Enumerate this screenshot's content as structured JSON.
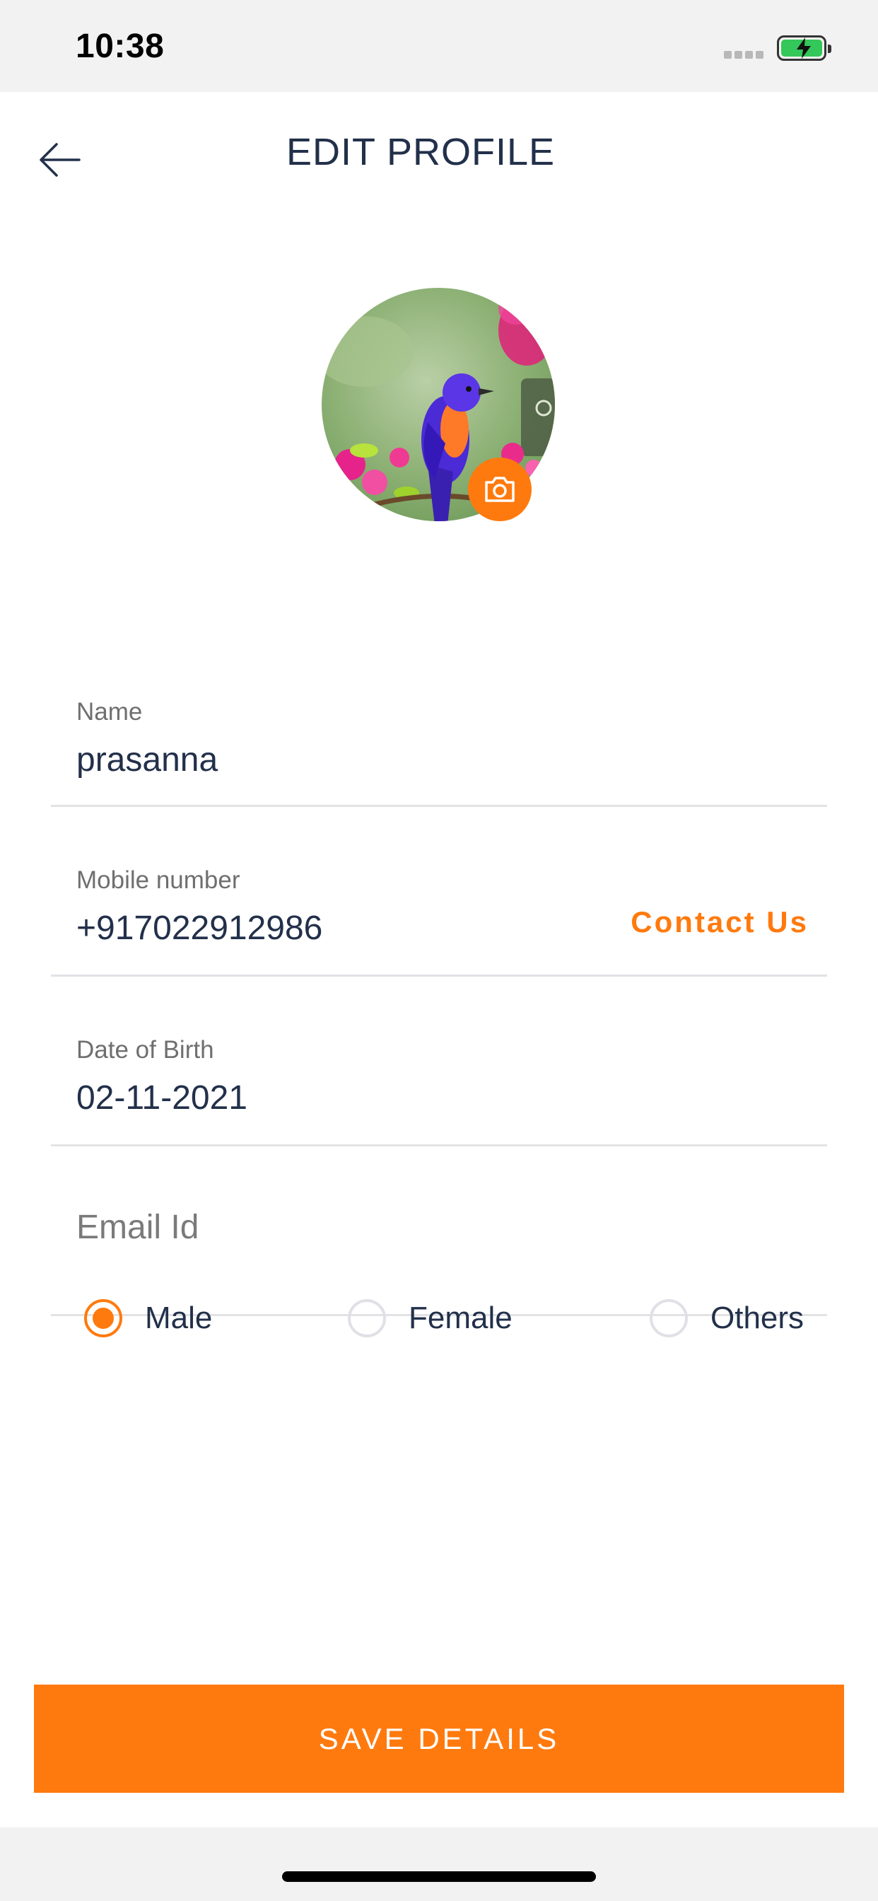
{
  "status_bar": {
    "time": "10:38"
  },
  "header": {
    "title": "EDIT PROFILE",
    "back_icon": "arrow-left-icon"
  },
  "profile": {
    "avatar_description": "bird-photo",
    "camera_icon": "camera-icon"
  },
  "fields": {
    "name": {
      "label": "Name",
      "value": "prasanna"
    },
    "mobile": {
      "label": "Mobile number",
      "value": "+917022912986",
      "action": "Contact Us"
    },
    "dob": {
      "label": "Date of Birth",
      "value": "02-11-2021"
    },
    "email": {
      "placeholder": "Email Id",
      "value": ""
    }
  },
  "gender": {
    "options": [
      {
        "label": "Male",
        "selected": true
      },
      {
        "label": "Female",
        "selected": false
      },
      {
        "label": "Others",
        "selected": false
      }
    ]
  },
  "actions": {
    "save_label": "SAVE DETAILS"
  },
  "colors": {
    "accent": "#ff7a0e",
    "text": "#22304a",
    "label": "#6f6f6f",
    "divider": "#e3e3e6"
  }
}
